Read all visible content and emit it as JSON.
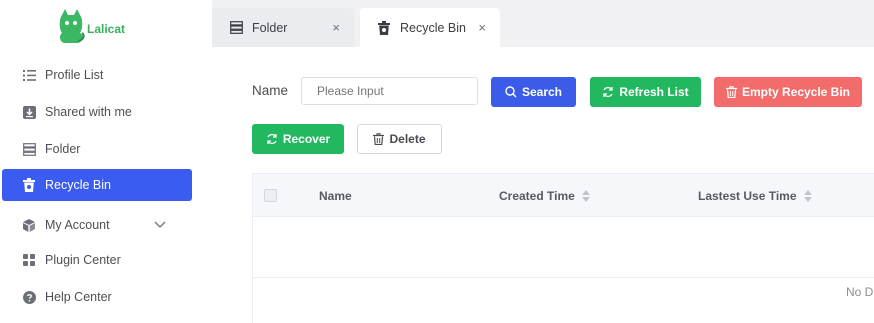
{
  "app": {
    "logo_text": "Lalicat"
  },
  "sidebar": {
    "items": [
      {
        "label": "Profile List",
        "icon": "list-icon"
      },
      {
        "label": "Shared with me",
        "icon": "download-box-icon"
      },
      {
        "label": "Folder",
        "icon": "folder-stack-icon"
      },
      {
        "label": "Recycle Bin",
        "icon": "trash-bin-icon",
        "active": true
      },
      {
        "label": "My Account",
        "icon": "cubes-icon",
        "expandable": true
      },
      {
        "label": "Plugin Center",
        "icon": "grid-icon"
      },
      {
        "label": "Help Center",
        "icon": "question-circle-icon"
      }
    ]
  },
  "tabs": [
    {
      "label": "Folder",
      "icon": "folder-stack-icon",
      "close": "×"
    },
    {
      "label": "Recycle Bin",
      "icon": "trash-bin-icon",
      "close": "×",
      "active": true
    }
  ],
  "filters": {
    "name_label": "Name",
    "name_placeholder": "Please Input",
    "name_value": ""
  },
  "toolbar": {
    "search_label": "Search",
    "refresh_label": "Refresh List",
    "empty_label": "Empty Recycle Bin",
    "recover_label": "Recover",
    "delete_label": "Delete"
  },
  "table": {
    "columns": [
      "Name",
      "Created Time",
      "Lastest Use Time"
    ],
    "empty_text": "No Data",
    "rows": []
  },
  "colors": {
    "primary": "#3b5cf0",
    "success": "#22b860",
    "danger": "#f26c6c",
    "brand": "#39b25e"
  }
}
